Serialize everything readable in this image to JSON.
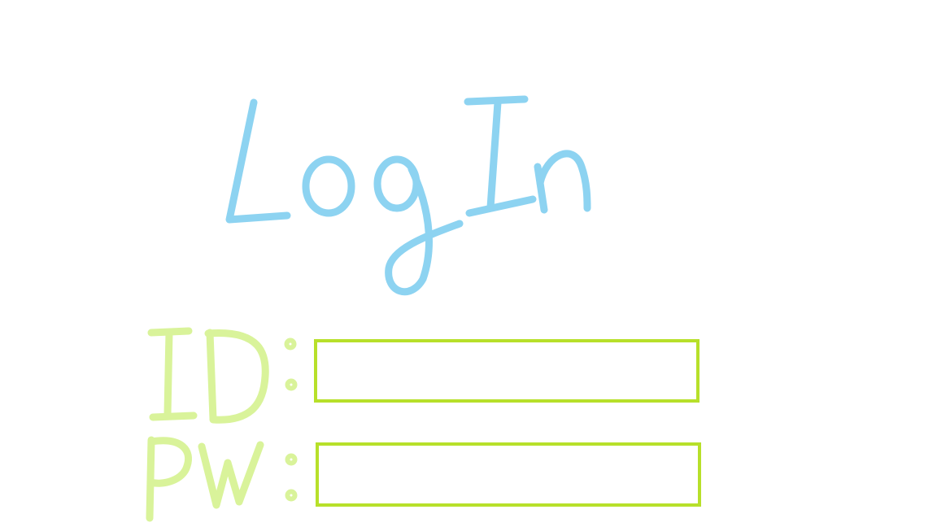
{
  "title": "LogIn",
  "form": {
    "id_label": "ID :",
    "id_value": "",
    "pw_label": "PW :",
    "pw_value": ""
  },
  "colors": {
    "title_stroke": "#8dd3f1",
    "label_stroke": "#d9f39a",
    "field_border": "#b7e02a",
    "background": "#ffffff"
  }
}
